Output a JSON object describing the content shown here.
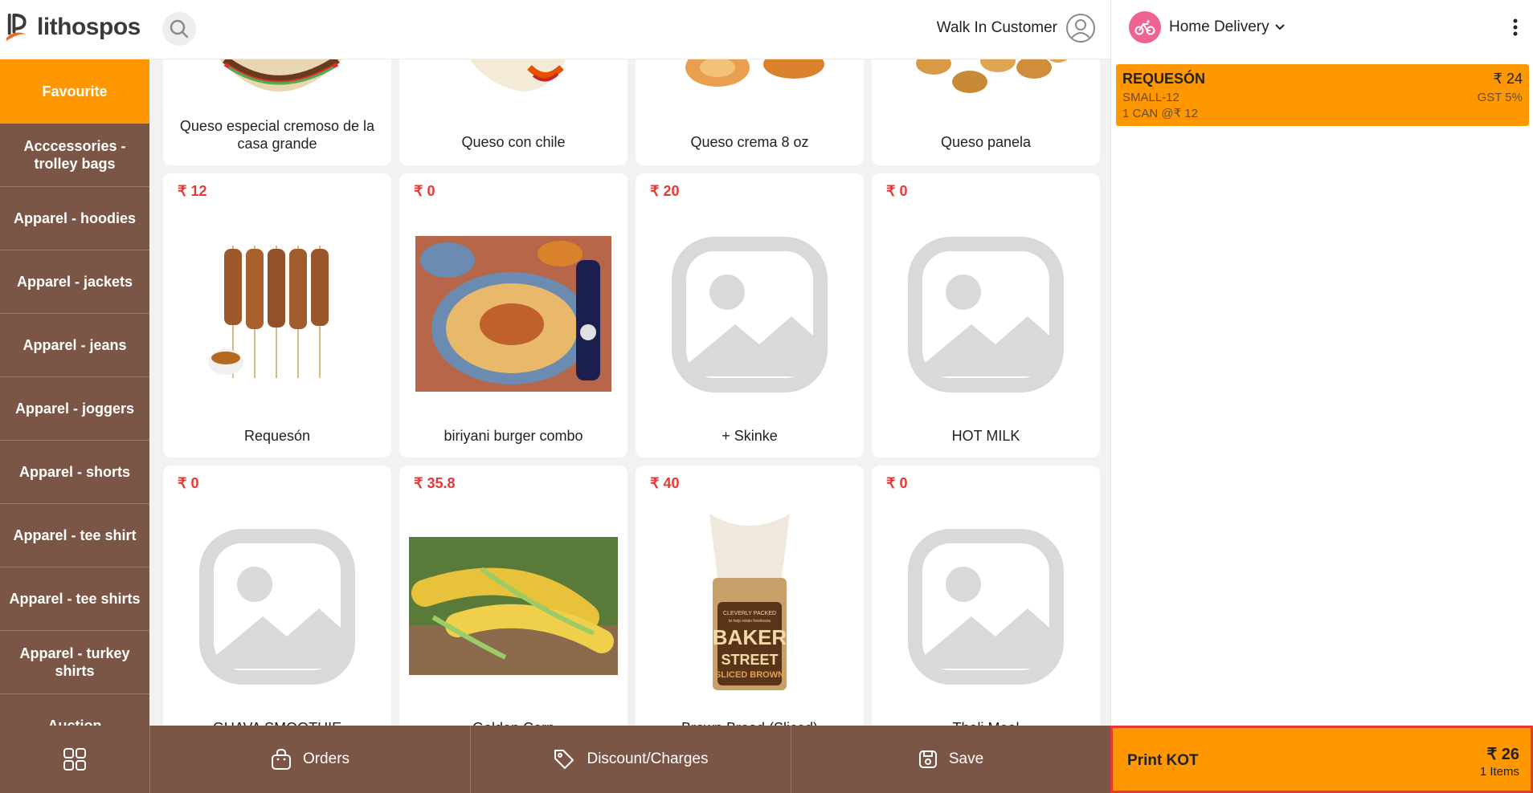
{
  "app": {
    "logo_text": "lithospos"
  },
  "header": {
    "customer_label": "Walk In Customer"
  },
  "categories": [
    {
      "label": "Favourite",
      "active": true
    },
    {
      "label": "Acccessories - trolley bags"
    },
    {
      "label": "Apparel - hoodies"
    },
    {
      "label": "Apparel - jackets"
    },
    {
      "label": "Apparel - jeans"
    },
    {
      "label": "Apparel - joggers"
    },
    {
      "label": "Apparel - shorts"
    },
    {
      "label": "Apparel - tee shirt"
    },
    {
      "label": "Apparel - tee shirts"
    },
    {
      "label": "Apparel - turkey shirts"
    },
    {
      "label": "Auction"
    }
  ],
  "products_row0": [
    {
      "name": "Queso especial cremoso de la casa grande",
      "image": "burrito-photo"
    },
    {
      "name": "Queso con chile",
      "image": "wrap-photo"
    },
    {
      "name": "Queso crema 8 oz",
      "image": "fried-chicken-photo"
    },
    {
      "name": "Queso panela",
      "image": "nuggets-photo"
    }
  ],
  "products_row1": [
    {
      "price": "₹ 12",
      "name": "Requesón",
      "image": "kebab-skewers-photo"
    },
    {
      "price": "₹ 0",
      "name": "biriyani burger combo",
      "image": "biryani-pepsi-photo"
    },
    {
      "price": "₹ 20",
      "name": "+ Skinke",
      "image": "placeholder-image-icon"
    },
    {
      "price": "₹ 0",
      "name": "HOT MILK",
      "image": "placeholder-image-icon"
    }
  ],
  "products_row2": [
    {
      "price": "₹ 0",
      "name": "GUAVA SMOOTHIE",
      "image": "placeholder-image-icon"
    },
    {
      "price": "₹ 35.8",
      "name": "Golden Corn",
      "image": "corn-photo"
    },
    {
      "price": "₹ 40",
      "name": "Brown Bread (Sliced)",
      "image": "bread-bag-photo",
      "bread_brand": [
        "CLEVERLY PACKED",
        "to help retain freshness",
        "BAKER",
        "STREET",
        "SLICED BROWN"
      ]
    },
    {
      "price": "₹ 0",
      "name": "Thali Meal",
      "image": "placeholder-image-icon"
    }
  ],
  "bottombar": {
    "orders_label": "Orders",
    "discount_label": "Discount/Charges",
    "save_label": "Save"
  },
  "order": {
    "type_label": "Home Delivery",
    "items": [
      {
        "name": "REQUESÓN",
        "price": "₹ 24",
        "variant": "SMALL-12",
        "gst": "GST 5%",
        "qty_line": "1 CAN @₹ 12"
      }
    ]
  },
  "print_kot": {
    "label": "Print KOT",
    "total": "₹ 26",
    "count": "1 Items"
  },
  "colors": {
    "accent": "#ff9800",
    "sidebar": "#7b5546",
    "price": "#e53935",
    "placeholder": "#d9d9d9"
  }
}
